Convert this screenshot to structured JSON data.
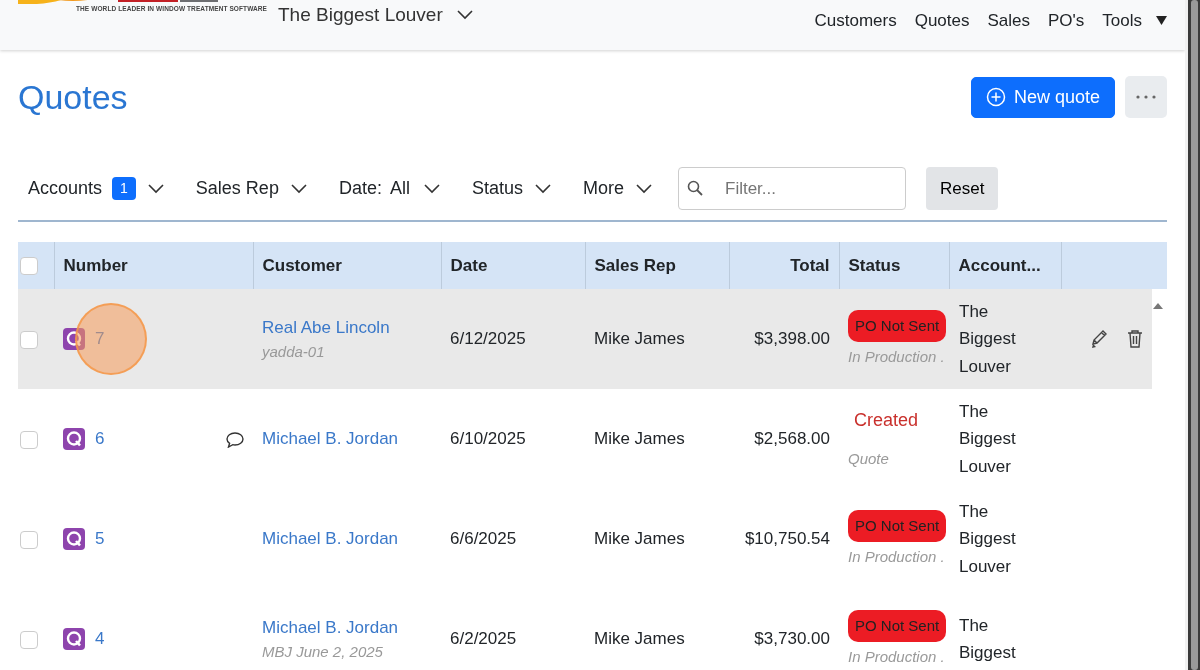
{
  "header": {
    "logo_tagline": "THE WORLD LEADER IN WINDOW TREATMENT SOFTWARE",
    "account_selector": "The Biggest Louver",
    "nav": [
      {
        "label": "Customers",
        "dropdown": false
      },
      {
        "label": "Quotes",
        "dropdown": false
      },
      {
        "label": "Sales",
        "dropdown": false
      },
      {
        "label": "PO's",
        "dropdown": false
      },
      {
        "label": "Tools",
        "dropdown": true
      }
    ]
  },
  "page": {
    "title": "Quotes",
    "new_button": "New quote"
  },
  "filters": [
    {
      "label": "Accounts",
      "badge": "1"
    },
    {
      "label": "Sales Rep"
    },
    {
      "label": "Date:",
      "value": "All"
    },
    {
      "label": "Status"
    },
    {
      "label": "More"
    }
  ],
  "search": {
    "placeholder": "Filter..."
  },
  "reset_button": "Reset",
  "table": {
    "header_checked": false,
    "columns": [
      {
        "label": "Number"
      },
      {
        "label": "Customer"
      },
      {
        "label": "Date"
      },
      {
        "label": "Sales Rep"
      },
      {
        "label": "Total"
      },
      {
        "label": "Status"
      },
      {
        "label": "Account..."
      }
    ],
    "rows": [
      {
        "checked": false,
        "hovered": true,
        "click_indicator": true,
        "number": "7",
        "has_comment": false,
        "customer": "Real Abe Lincoln",
        "customer_note": "yadda-01",
        "date": "6/12/2025",
        "sales_rep": "Mike James",
        "total": "$3,398.00",
        "status": {
          "kind": "badge",
          "label": "PO Not Sent",
          "detail": "In Production ."
        },
        "account": "The Biggest Louver"
      },
      {
        "checked": false,
        "hovered": false,
        "click_indicator": false,
        "number": "6",
        "has_comment": true,
        "customer": "Michael B. Jordan",
        "date": "6/10/2025",
        "sales_rep": "Mike James",
        "total": "$2,568.00",
        "status": {
          "kind": "text",
          "label": "Created",
          "detail": "Quote"
        },
        "account": "The Biggest Louver"
      },
      {
        "checked": false,
        "hovered": false,
        "click_indicator": false,
        "number": "5",
        "has_comment": false,
        "customer": "Michael B. Jordan",
        "date": "6/6/2025",
        "sales_rep": "Mike James",
        "total": "$10,750.54",
        "status": {
          "kind": "badge",
          "label": "PO Not Sent",
          "detail": "In Production ."
        },
        "account": "The Biggest Louver"
      },
      {
        "checked": false,
        "hovered": false,
        "click_indicator": false,
        "number": "4",
        "has_comment": false,
        "customer": "Michael B. Jordan",
        "customer_note": "MBJ June 2, 2025",
        "date": "6/2/2025",
        "sales_rep": "Mike James",
        "total": "$3,730.00",
        "status": {
          "kind": "badge",
          "label": "PO Not Sent",
          "detail": "In Production ."
        },
        "account": "The Biggest"
      }
    ]
  }
}
